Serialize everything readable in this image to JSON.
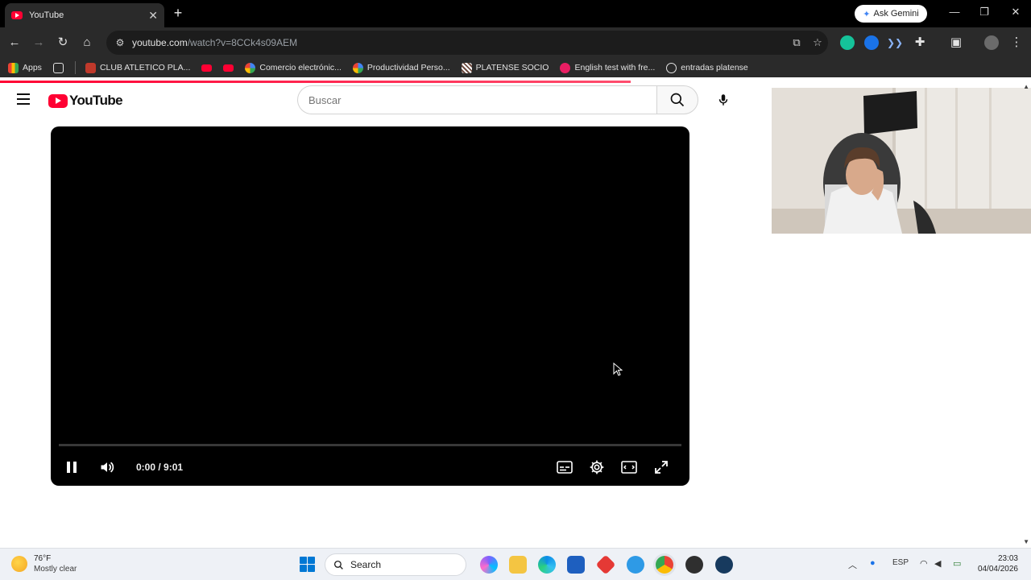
{
  "browser": {
    "tab": {
      "title": "YouTube"
    },
    "new_tab_symbol": "+",
    "ask_gemini_label": "Ask Gemini",
    "address": {
      "host": "youtube.com",
      "path": "/watch?v=8CCk4s09AEM"
    },
    "bookmarks": [
      {
        "label": "Apps",
        "icon": "apps-grid-icon",
        "color": "#4285f4"
      },
      {
        "label": "CLUB ATLETICO PLA...",
        "icon": "club-crest-icon",
        "color": "#c0392b"
      },
      {
        "label": "",
        "icon": "youtube-bookmark-icon",
        "color": "#ff0033"
      },
      {
        "label": "",
        "icon": "youtube-bookmark-icon",
        "color": "#ff0033"
      },
      {
        "label": "Comercio electrónic...",
        "icon": "google-icon",
        "color": "#4285f4"
      },
      {
        "label": "Productividad Perso...",
        "icon": "google-icon",
        "color": "#4285f4"
      },
      {
        "label": "PLATENSE SOCIO",
        "icon": "platense-icon",
        "color": "#8b5a2b"
      },
      {
        "label": "English test with fre...",
        "icon": "ef-icon",
        "color": "#e91e63"
      },
      {
        "label": "entradas platense",
        "icon": "globe-icon",
        "color": "#bdbdbd"
      }
    ]
  },
  "youtube": {
    "logo_text": "YouTube",
    "search_placeholder": "Buscar",
    "player": {
      "current_time": "0:00",
      "duration": "9:01",
      "time_display": "0:00 / 9:01",
      "progress_fraction": 0.0
    }
  },
  "taskbar": {
    "weather": {
      "temp": "76°F",
      "condition": "Mostly clear"
    },
    "search_label": "Search",
    "language": "ESP",
    "time": "23:03",
    "date": "04/04/2026"
  },
  "colors": {
    "youtube_red": "#ff0033",
    "chrome_dark": "#2a2a2a",
    "windows_blue": "#0078d4"
  }
}
